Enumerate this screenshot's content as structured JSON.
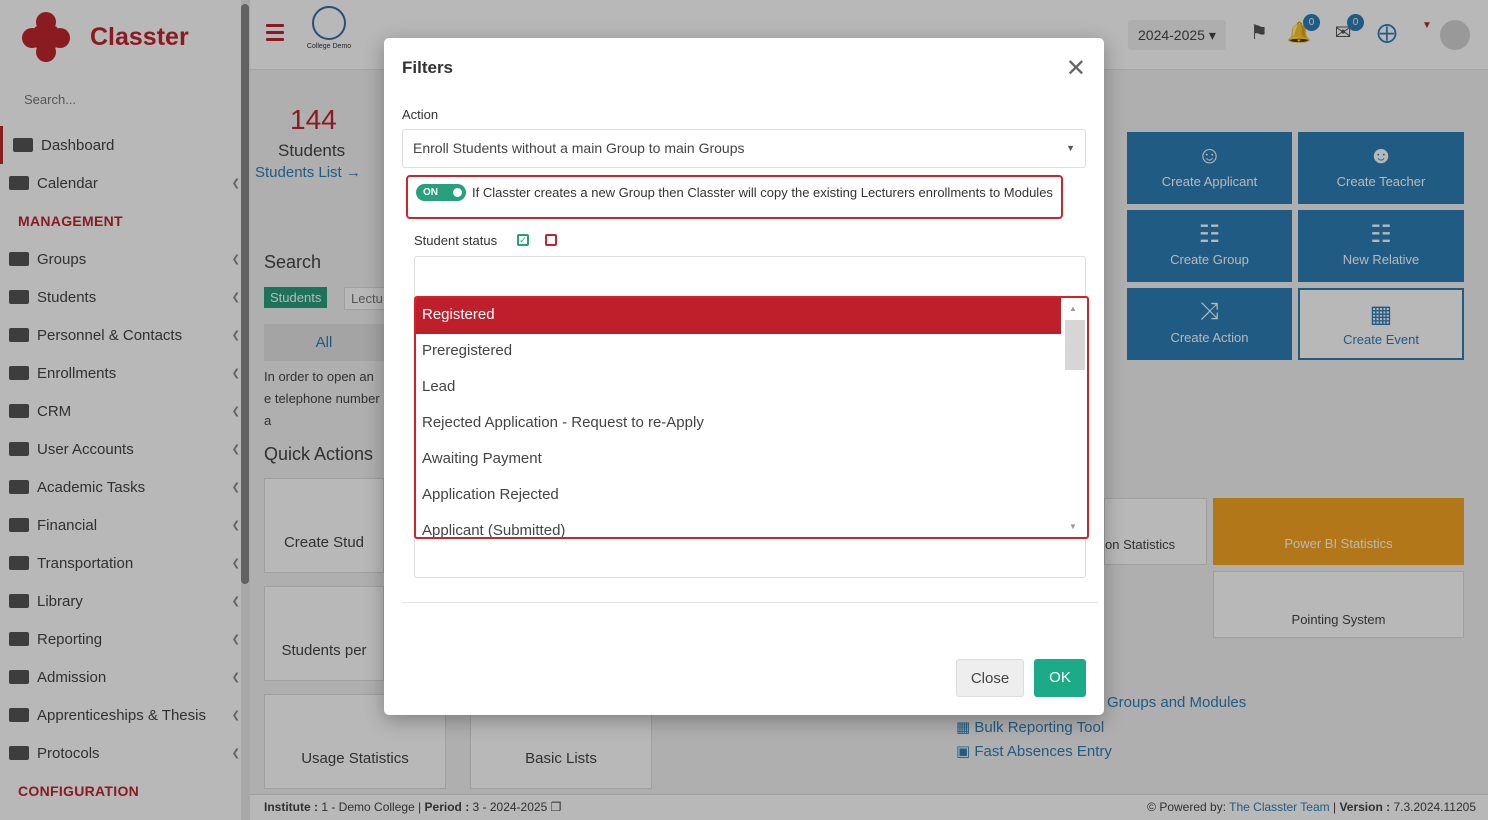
{
  "app": {
    "name": "Classter",
    "college_logo_text": "College Demo",
    "search_placeholder": "Search..."
  },
  "sidebar": {
    "items": [
      {
        "label": "Dashboard",
        "icon": "laptop-icon",
        "active": true
      },
      {
        "label": "Calendar",
        "icon": "calendar-icon"
      },
      {
        "heading": "MANAGEMENT"
      },
      {
        "label": "Groups",
        "icon": "groups-icon"
      },
      {
        "label": "Students",
        "icon": "students-icon"
      },
      {
        "label": "Personnel & Contacts",
        "icon": "person-icon"
      },
      {
        "label": "Enrollments",
        "icon": "arrows-icon"
      },
      {
        "label": "CRM",
        "icon": "shuffle-icon"
      },
      {
        "label": "User Accounts",
        "icon": "key-icon"
      },
      {
        "label": "Academic Tasks",
        "icon": "grid-icon"
      },
      {
        "label": "Financial",
        "icon": "coins-icon"
      },
      {
        "label": "Transportation",
        "icon": "bus-icon"
      },
      {
        "label": "Library",
        "icon": "books-icon"
      },
      {
        "label": "Reporting",
        "icon": "printer-icon"
      },
      {
        "label": "Admission",
        "icon": "building-icon"
      },
      {
        "label": "Apprenticeships & Thesis",
        "icon": "cubes-icon"
      },
      {
        "label": "Protocols",
        "icon": "protocols-icon"
      },
      {
        "heading": "CONFIGURATION"
      }
    ]
  },
  "header": {
    "year": "2024-2025",
    "notifications_count": "0",
    "messages_count": "0"
  },
  "background": {
    "student_count": "144",
    "students_label": "Students",
    "students_list_link": "Students List",
    "search_title": "Search",
    "search_tab": "Students",
    "search_tab2": "Lectu",
    "all_tab": "All",
    "help_text": "In order to open an e telephone number a",
    "quick_actions_title": "Quick Actions",
    "cards": [
      "Create Stud",
      "Students per",
      "Usage Statistics",
      "Basic Lists"
    ],
    "tiles": [
      "Create Applicant",
      "Create Teacher",
      "Create Group",
      "New Relative",
      "Create Action",
      "Create Event"
    ],
    "stats": [
      "on Statistics",
      "Power BI Statistics",
      "Pointing System"
    ],
    "links": [
      "Groups and Modules",
      "Bulk Reporting Tool",
      "Fast Absences Entry"
    ]
  },
  "footer": {
    "institute_label": "Institute :",
    "institute_value": "1 - Demo College",
    "period_label": "Period :",
    "period_value": "3 - 2024-2025",
    "powered_by": "Powered by:",
    "team": "The Classter Team",
    "version_label": "Version :",
    "version_value": "7.3.2024.11205"
  },
  "modal": {
    "title": "Filters",
    "action_label": "Action",
    "action_value": "Enroll Students without a main Group to main Groups",
    "toggle_state": "ON",
    "toggle_text": "If Classter creates a new Group then Classter will copy the existing Lecturers enrollments to Modules",
    "student_status_label": "Student status",
    "status_options": [
      "Registered",
      "Preregistered",
      "Lead",
      "Rejected Application - Request to re-Apply",
      "Awaiting Payment",
      "Application Rejected",
      "Applicant (Submitted)"
    ],
    "close_label": "Close",
    "ok_label": "OK"
  },
  "colors": {
    "brand": "#c0262d",
    "blue": "#2d7fb6",
    "green": "#1cab89",
    "highlight": "#d2232a"
  }
}
